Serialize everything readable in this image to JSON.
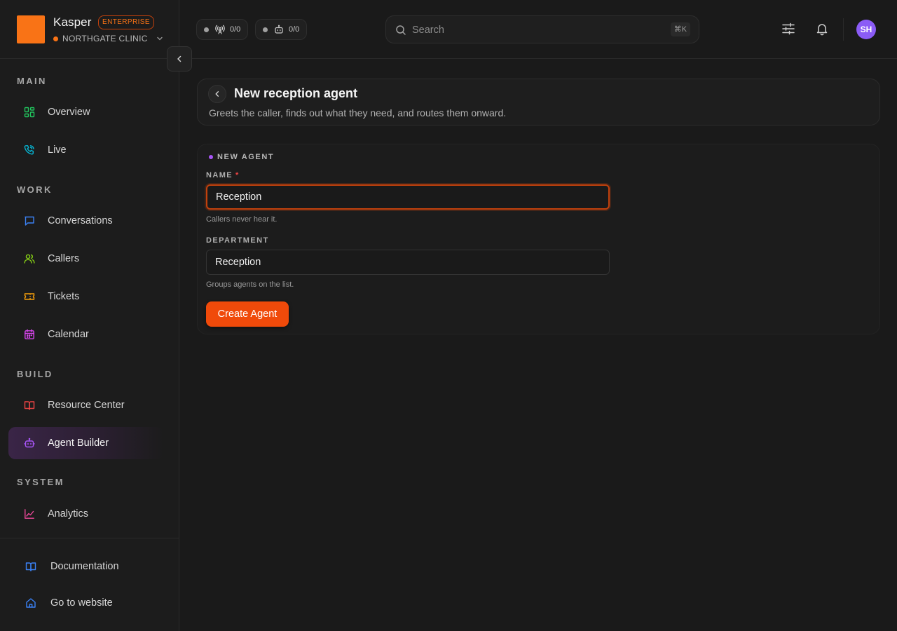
{
  "brand": {
    "name": "Kasper",
    "badge": "ENTERPRISE",
    "org": "NORTHGATE CLINIC",
    "logo_color": "#f97316"
  },
  "sidebar": {
    "sections": [
      {
        "title": "MAIN"
      },
      {
        "title": "WORK"
      },
      {
        "title": "BUILD"
      },
      {
        "title": "SYSTEM"
      }
    ],
    "items": [
      {
        "label": "Overview",
        "icon": "dashboard-icon",
        "color": "#22c55e"
      },
      {
        "label": "Live",
        "icon": "phone-call-icon",
        "color": "#06b6d4"
      },
      {
        "label": "Conversations",
        "icon": "chat-bubble-icon",
        "color": "#3b82f6"
      },
      {
        "label": "Callers",
        "icon": "users-icon",
        "color": "#84cc16"
      },
      {
        "label": "Tickets",
        "icon": "ticket-icon",
        "color": "#f59e0b"
      },
      {
        "label": "Calendar",
        "icon": "calendar-icon",
        "color": "#d946ef"
      },
      {
        "label": "Resource Center",
        "icon": "book-open-icon",
        "color": "#ef4444"
      },
      {
        "label": "Agent Builder",
        "icon": "bot-icon",
        "color": "#a855f7",
        "active": true
      },
      {
        "label": "Analytics",
        "icon": "line-chart-icon",
        "color": "#ec4899"
      }
    ],
    "footer": [
      {
        "label": "Documentation",
        "icon": "book-open-icon",
        "color": "#3b82f6"
      },
      {
        "label": "Go to website",
        "icon": "home-icon",
        "color": "#3b82f6"
      }
    ]
  },
  "topbar": {
    "status": [
      {
        "icon": "broadcast-icon",
        "count": "0/0"
      },
      {
        "icon": "bot-icon",
        "count": "0/0"
      }
    ],
    "search": {
      "placeholder": "Search",
      "shortcut": "⌘K"
    },
    "avatar_initials": "SH",
    "avatar_color": "#8b5cf6"
  },
  "page": {
    "title": "New reception agent",
    "subtitle": "Greets the caller, finds out what they need, and routes them onward."
  },
  "form": {
    "tag": "NEW AGENT",
    "name_label": "NAME",
    "name_required": "*",
    "name_value": "Reception",
    "name_help": "Callers never hear it.",
    "department_label": "DEPARTMENT",
    "department_value": "Reception",
    "department_help": "Groups agents on the list.",
    "submit_label": "Create Agent",
    "accent": "#f04a0a"
  }
}
